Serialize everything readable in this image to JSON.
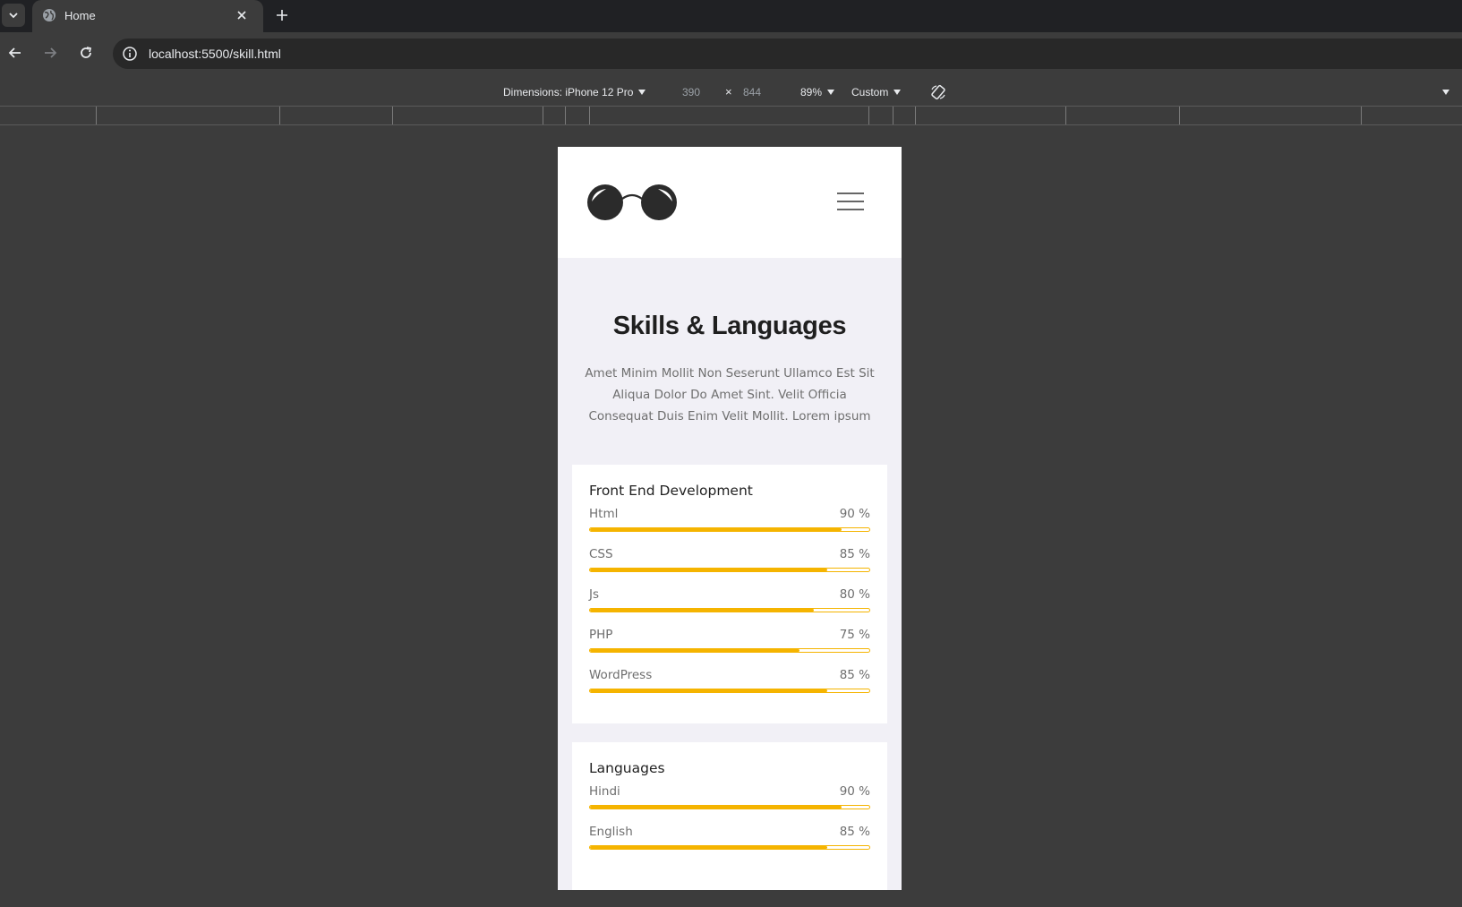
{
  "browser": {
    "tab_title": "Home",
    "url": "localhost:5500/skill.html"
  },
  "devtools": {
    "dimensions_label": "Dimensions: iPhone 12 Pro",
    "width": "390",
    "times": "×",
    "height": "844",
    "zoom": "89%",
    "throttle": "Custom"
  },
  "page": {
    "hero": {
      "title": "Skills & Languages",
      "description": "Amet Minim Mollit Non Seserunt Ullamco Est Sit Aliqua Dolor Do Amet Sint. Velit Officia Consequat Duis Enim Velit Mollit. Lorem ipsum"
    },
    "frontend": {
      "title": "Front End Development",
      "skills": [
        {
          "name": "Html",
          "percent_label": "90 %",
          "level": 0.9
        },
        {
          "name": "CSS",
          "percent_label": "85 %",
          "level": 0.85
        },
        {
          "name": "Js",
          "percent_label": "80 %",
          "level": 0.8
        },
        {
          "name": "PHP",
          "percent_label": "75 %",
          "level": 0.75
        },
        {
          "name": "WordPress",
          "percent_label": "85 %",
          "level": 0.85
        }
      ]
    },
    "languages": {
      "title": "Languages",
      "skills": [
        {
          "name": "Hindi",
          "percent_label": "90 %",
          "level": 0.9
        },
        {
          "name": "English",
          "percent_label": "85 %",
          "level": 0.85
        }
      ]
    }
  },
  "colors": {
    "accent": "#f5b400",
    "page_bg": "#f1f0f6",
    "devtools_bg": "#3c3c3c"
  }
}
